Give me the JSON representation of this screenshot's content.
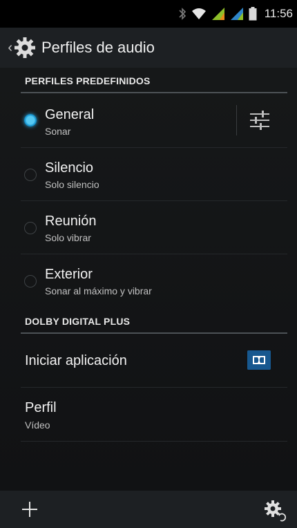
{
  "status_bar": {
    "time": "11:56",
    "icons": [
      "bluetooth-icon",
      "wifi-icon",
      "signal-sim1-icon",
      "signal-sim2-icon",
      "battery-icon"
    ]
  },
  "action_bar": {
    "title": "Perfiles de audio",
    "icon": "gear-icon"
  },
  "sections": {
    "predefined": {
      "header": "PERFILES PREDEFINIDOS"
    },
    "dolby": {
      "header": "DOLBY DIGITAL PLUS"
    }
  },
  "profiles": [
    {
      "title": "General",
      "subtitle": "Sonar",
      "selected": true
    },
    {
      "title": "Silencio",
      "subtitle": "Solo silencio",
      "selected": false
    },
    {
      "title": "Reunión",
      "subtitle": "Solo vibrar",
      "selected": false
    },
    {
      "title": "Exterior",
      "subtitle": "Sonar al máximo y vibrar",
      "selected": false
    }
  ],
  "dolby_items": {
    "launch": {
      "title": "Iniciar aplicación",
      "icon": "dolby-logo-icon"
    },
    "profile": {
      "title": "Perfil",
      "subtitle": "Vídeo"
    }
  },
  "bottom_bar": {
    "left_icon": "add-icon",
    "right_icon": "settings-reset-icon"
  },
  "colors": {
    "accent": "#1b9ad4",
    "dolby": "#17588f",
    "bar": "#1d2023"
  }
}
